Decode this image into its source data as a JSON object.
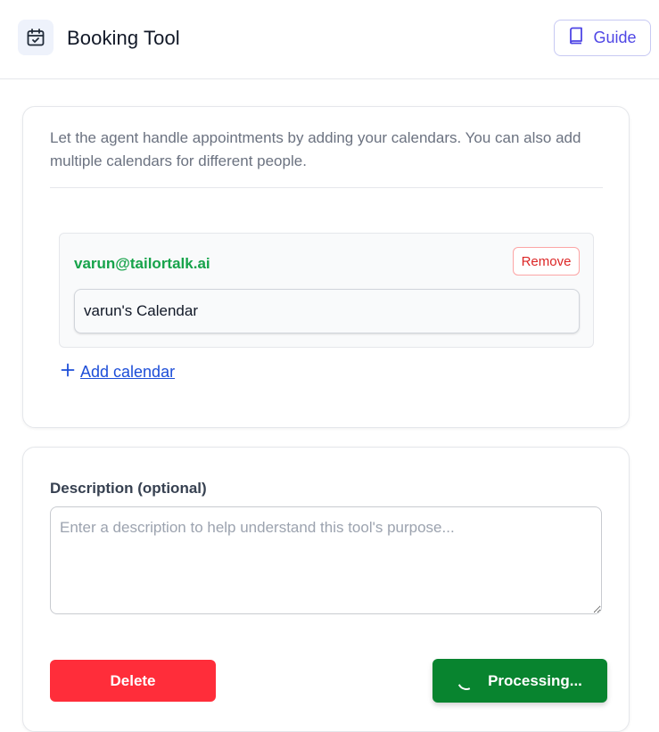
{
  "header": {
    "title": "Booking Tool",
    "guide_label": "Guide",
    "icon": "calendar-check-icon"
  },
  "calendars_card": {
    "intro": "Let the agent handle appointments by adding your calendars. You can also add multiple calendars for different people.",
    "items": [
      {
        "email": "varun@tailortalk.ai",
        "remove_label": "Remove",
        "selected_calendar": "varun's Calendar"
      }
    ],
    "add_label": "Add calendar"
  },
  "description_card": {
    "label": "Description (optional)",
    "placeholder": "Enter a description to help understand this tool's purpose...",
    "value": ""
  },
  "actions": {
    "delete_label": "Delete",
    "processing_label": "Processing..."
  },
  "colors": {
    "accent": "#4f46e5",
    "email": "#16a34a",
    "link": "#1d4ed8",
    "danger": "#ff2d3a",
    "success": "#08842f"
  }
}
